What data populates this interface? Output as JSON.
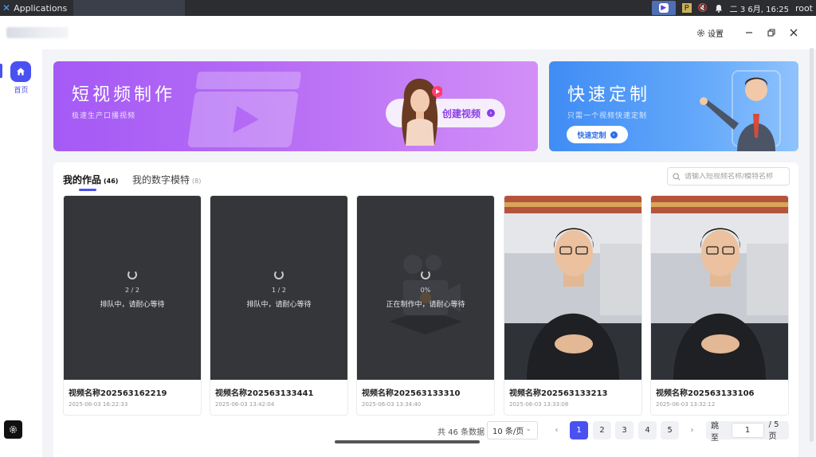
{
  "os": {
    "apps_label": "Applications",
    "clock": "二 3 6月, 16:25",
    "user": "root"
  },
  "window": {
    "settings_label": "设置"
  },
  "sidebar": {
    "home_label": "首页"
  },
  "banners": {
    "short_video": {
      "title": "短视频制作",
      "subtitle": "极速生产口播视频",
      "cta": "创建视频"
    },
    "custom": {
      "title": "快速定制",
      "subtitle": "只需一个视频快速定制",
      "cta": "快速定制"
    }
  },
  "tabs": [
    {
      "label": "我的作品",
      "count": "(46)"
    },
    {
      "label": "我的数字模特",
      "count": "(8)"
    }
  ],
  "search": {
    "placeholder": "请输入短视频名称/模特名称"
  },
  "cards": [
    {
      "name": "视频名称202563162219",
      "date": "2025-06-03 16:22:33",
      "progress": "2 / 2",
      "status": "排队中，请耐心等待"
    },
    {
      "name": "视频名称202563133441",
      "date": "2025-06-03 13:42:04",
      "progress": "1 / 2",
      "status": "排队中，请耐心等待"
    },
    {
      "name": "视频名称202563133310",
      "date": "2025-06-03 13:34:40",
      "progress": "0%",
      "status": "正在制作中，请耐心等待"
    },
    {
      "name": "视频名称202563133213",
      "date": "2025-06-03 13:33:08"
    },
    {
      "name": "视频名称202563133106",
      "date": "2025-06-03 13:32:12"
    }
  ],
  "pagination": {
    "total": "共 46 条数据",
    "page_size": "10 条/页",
    "pages": [
      "1",
      "2",
      "3",
      "4",
      "5"
    ],
    "current": "1",
    "jump_label": "跳至",
    "jump_value": "1",
    "total_pages": "/ 5 页"
  },
  "colors": {
    "accent": "#4a51f0",
    "banner_purple": "#a45af5",
    "banner_blue": "#3f8cf5"
  }
}
